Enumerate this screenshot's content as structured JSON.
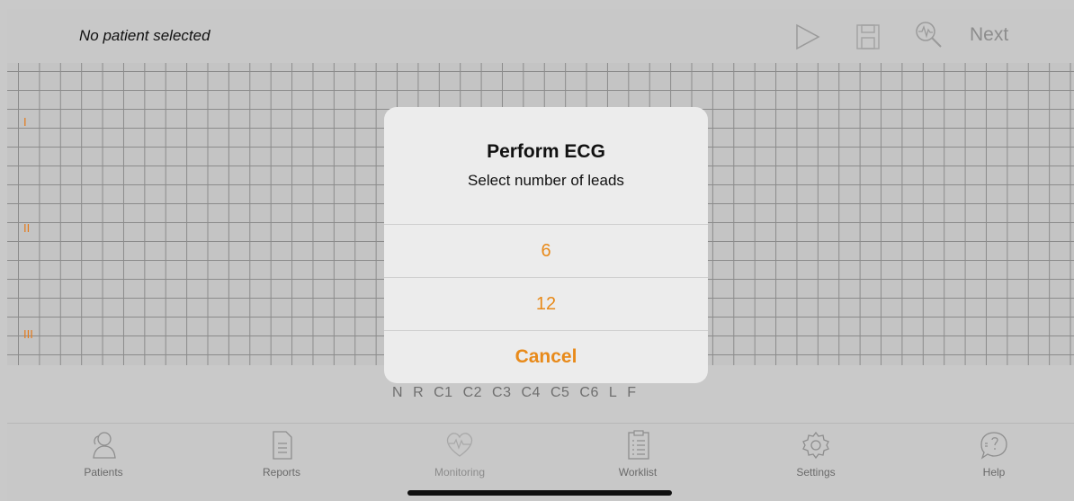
{
  "header": {
    "patient_status": "No patient selected",
    "next_label": "Next",
    "icons": [
      "play-icon",
      "save-icon",
      "search-ecg-icon"
    ]
  },
  "ecg": {
    "lead_labels": [
      "I",
      "II",
      "III"
    ],
    "electrodes": [
      "N",
      "R",
      "C1",
      "C2",
      "C3",
      "C4",
      "C5",
      "C6",
      "L",
      "F"
    ]
  },
  "dialog": {
    "title": "Perform ECG",
    "message": "Select number of leads",
    "options": [
      "6",
      "12"
    ],
    "cancel_label": "Cancel"
  },
  "tabs": [
    {
      "label": "Patients",
      "icon": "patients-icon",
      "enabled": true
    },
    {
      "label": "Reports",
      "icon": "reports-icon",
      "enabled": true
    },
    {
      "label": "Monitoring",
      "icon": "monitoring-icon",
      "enabled": false
    },
    {
      "label": "Worklist",
      "icon": "worklist-icon",
      "enabled": true
    },
    {
      "label": "Settings",
      "icon": "settings-icon",
      "enabled": true
    },
    {
      "label": "Help",
      "icon": "help-icon",
      "enabled": true
    }
  ],
  "colors": {
    "accent": "#e88a1a",
    "lead_label": "#e57a1a",
    "background": "#c9c9c9",
    "dialog": "#ececec"
  }
}
